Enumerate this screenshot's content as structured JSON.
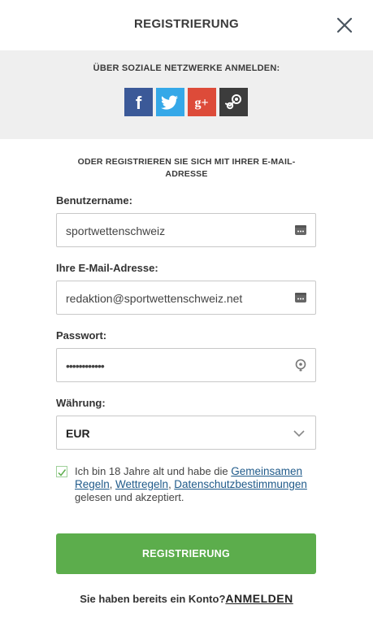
{
  "header": {
    "title": "REGISTRIERUNG",
    "close_icon": "close-icon"
  },
  "social": {
    "title": "ÜBER SOZIALE NETZWERKE ANMELDEN:",
    "buttons": [
      {
        "icon": "facebook-icon",
        "color": "#3b5998"
      },
      {
        "icon": "twitter-icon",
        "color": "#35a8e8"
      },
      {
        "icon": "google-plus-icon",
        "color": "#dd4b39"
      },
      {
        "icon": "steam-icon",
        "color": "#3c3c3c"
      }
    ]
  },
  "email_section": {
    "title": "ODER REGISTRIEREN SIE SICH MIT IHRER E-MAIL-ADRESSE"
  },
  "form": {
    "username": {
      "label": "Benutzername:",
      "value": "sportwettenschweiz"
    },
    "email": {
      "label": "Ihre E-Mail-Adresse:",
      "value": "redaktion@sportwettenschweiz.net"
    },
    "password": {
      "label": "Passwort:",
      "value": "••••••••••••"
    },
    "currency": {
      "label": "Währung:",
      "value": "EUR"
    }
  },
  "terms": {
    "checked": true,
    "text_before": "Ich bin 18 Jahre alt und habe die ",
    "link_rules": "Gemeinsamen Regeln",
    "separator": ", ",
    "link_betting": "Wettregeln",
    "separator2": ", ",
    "link_privacy": "Datenschutzbestimmungen",
    "text_after": " gelesen und akzeptiert."
  },
  "submit": {
    "label": "REGISTRIERUNG",
    "color": "#5cad4c"
  },
  "login": {
    "question": "Sie haben bereits ein Konto?",
    "link": "ANMELDEN"
  }
}
